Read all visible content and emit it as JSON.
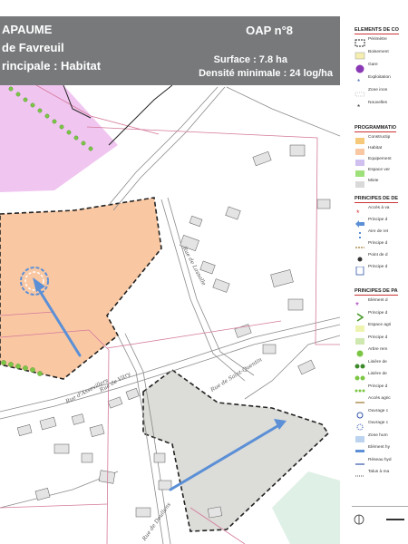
{
  "header": {
    "line1": "APAUME",
    "line2": "de Favreuil",
    "line3": "rincipale : Habitat",
    "oap": "OAP n°8",
    "surface": "Surface : 7.8 ha",
    "density": "Densité minimale : 24 log/ha"
  },
  "streets": {
    "s1": "Rue de Lassalle",
    "s2": "Rue de Vitry",
    "s3": "Rue de Saint-Quentin",
    "s4": "Rue d'Assevillers",
    "s5": "Rue de Doullens"
  },
  "legend": {
    "sec1": "ELEMENTS DE CO",
    "sec1_items": [
      "Périmètre",
      "Boisement",
      "Gare",
      "Exploitation",
      "Zone inon",
      "Nouvelles"
    ],
    "sec2": "PROGRAMMATIO",
    "sec2_items": [
      "Constructip",
      "Habitat",
      "Equipement",
      "Espace ver",
      "Mixte"
    ],
    "sec3": "PRINCIPES DE DE",
    "sec3_items": [
      "Accès à va",
      "Principe d",
      "Aire de ret",
      "Principe d",
      "Point de d",
      "Principe d"
    ],
    "sec4": "PRINCIPES DE PA",
    "sec4_items": [
      "Elément d",
      "Principe d",
      "Espace agri",
      "Principe d",
      "Arbre rem",
      "Lisière de",
      "Lisière de",
      "Principe d",
      "Accès agric",
      "Ouvrage c",
      "Ouvrage c",
      "Zone hum",
      "Elément hy",
      "Réseau hyd",
      "Talus à ma"
    ],
    "colors": {
      "habitat": "#f9c8a3",
      "equipement": "#cfc0f0",
      "espace_vert": "#9ee07a",
      "mixte": "#d9d9d9",
      "arrow": "#5b8fd6",
      "perimeter": "#d4789a"
    }
  }
}
